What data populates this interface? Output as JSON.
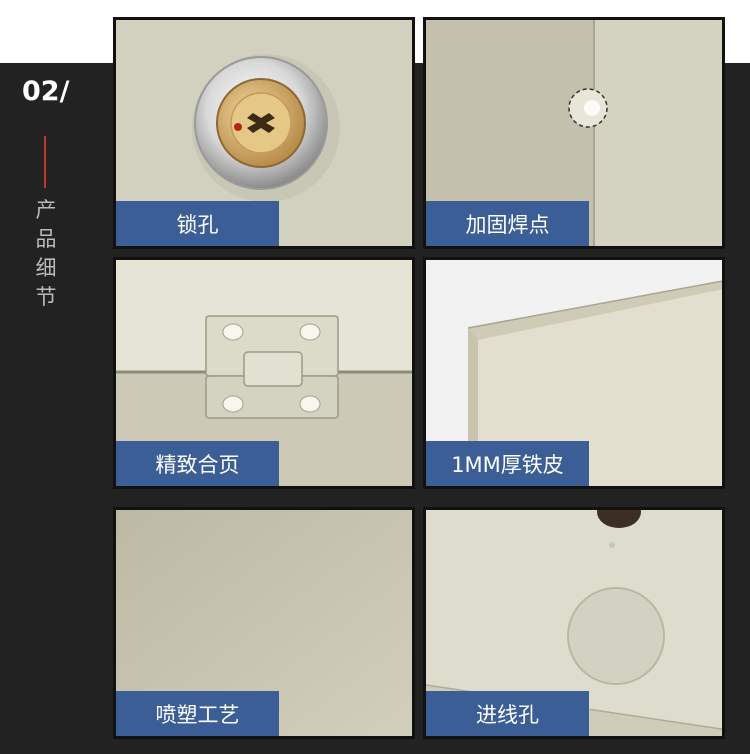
{
  "section": {
    "number": "02/",
    "title_chars": [
      "产",
      "品",
      "细",
      "节"
    ]
  },
  "panels": [
    {
      "caption": "锁孔"
    },
    {
      "caption": "加固焊点"
    },
    {
      "caption": "精致合页"
    },
    {
      "caption": "1MM厚铁皮"
    },
    {
      "caption": "喷塑工艺"
    },
    {
      "caption": "进线孔"
    }
  ],
  "colors": {
    "background_band": "#222222",
    "accent_line": "#c0392b",
    "caption_bg": "#3a5e95"
  }
}
